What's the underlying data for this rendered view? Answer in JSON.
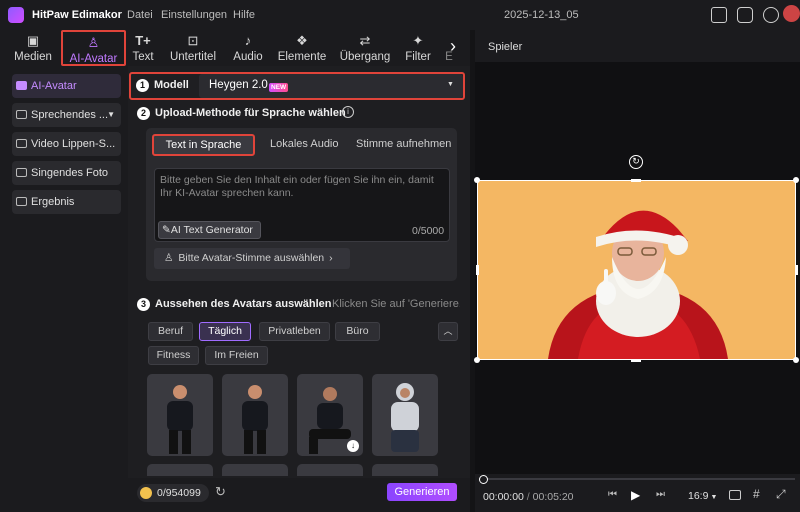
{
  "titlebar": {
    "app": "HitPaw Edimakor",
    "menus": [
      "Datei",
      "Einstellungen",
      "Hilfe"
    ],
    "date": "2025-12-13_05"
  },
  "toolbar": {
    "tabs": [
      {
        "label": "Medien",
        "icon": "media-icon"
      },
      {
        "label": "AI-Avatar",
        "icon": "avatar-icon"
      },
      {
        "label": "Text",
        "icon": "text-icon"
      },
      {
        "label": "Untertitel",
        "icon": "subtitle-icon"
      },
      {
        "label": "Audio",
        "icon": "music-icon"
      },
      {
        "label": "Elemente",
        "icon": "elements-icon"
      },
      {
        "label": "Übergang",
        "icon": "transition-icon"
      },
      {
        "label": "Filter",
        "icon": "filter-icon"
      },
      {
        "label": "E",
        "icon": "effects-icon"
      }
    ]
  },
  "sidebar": {
    "items": [
      {
        "label": "AI-Avatar"
      },
      {
        "label": "Sprechendes ..."
      },
      {
        "label": "Video Lippen-S..."
      },
      {
        "label": "Singendes Foto"
      },
      {
        "label": "Ergebnis"
      }
    ]
  },
  "main": {
    "step1": {
      "num": "1",
      "label": "Modell",
      "model": "Heygen 2.0",
      "badge": "NEW"
    },
    "step2": {
      "num": "2",
      "label": "Upload-Methode für Sprache wählen",
      "tabs": [
        "Text in Sprache",
        "Lokales Audio",
        "Stimme aufnehmen"
      ],
      "placeholder": "Bitte geben Sie den Inhalt ein oder fügen Sie ihn ein, damit Ihr KI-Avatar sprechen kann.",
      "ai_button": "AI Text Generator",
      "counter": "0/5000",
      "voice_button": "Bitte Avatar-Stimme auswählen"
    },
    "step3": {
      "num": "3",
      "label": "Aussehen des Avatars auswählen",
      "hint": "Klicken Sie auf 'Generiere...",
      "categories": [
        "Beruf",
        "Täglich",
        "Privatleben",
        "Büro",
        "Fitness",
        "Im Freien"
      ],
      "selected": "Täglich"
    }
  },
  "bottom": {
    "coins": "0/954099",
    "generate": "Generieren"
  },
  "player": {
    "title": "Spieler",
    "time_current": "00:00:00",
    "time_total": "00:05:20",
    "aspect": "16:9"
  },
  "colors": {
    "accent": "#a25cff",
    "highlight": "#e0443a",
    "canvas": "#f4b763"
  }
}
